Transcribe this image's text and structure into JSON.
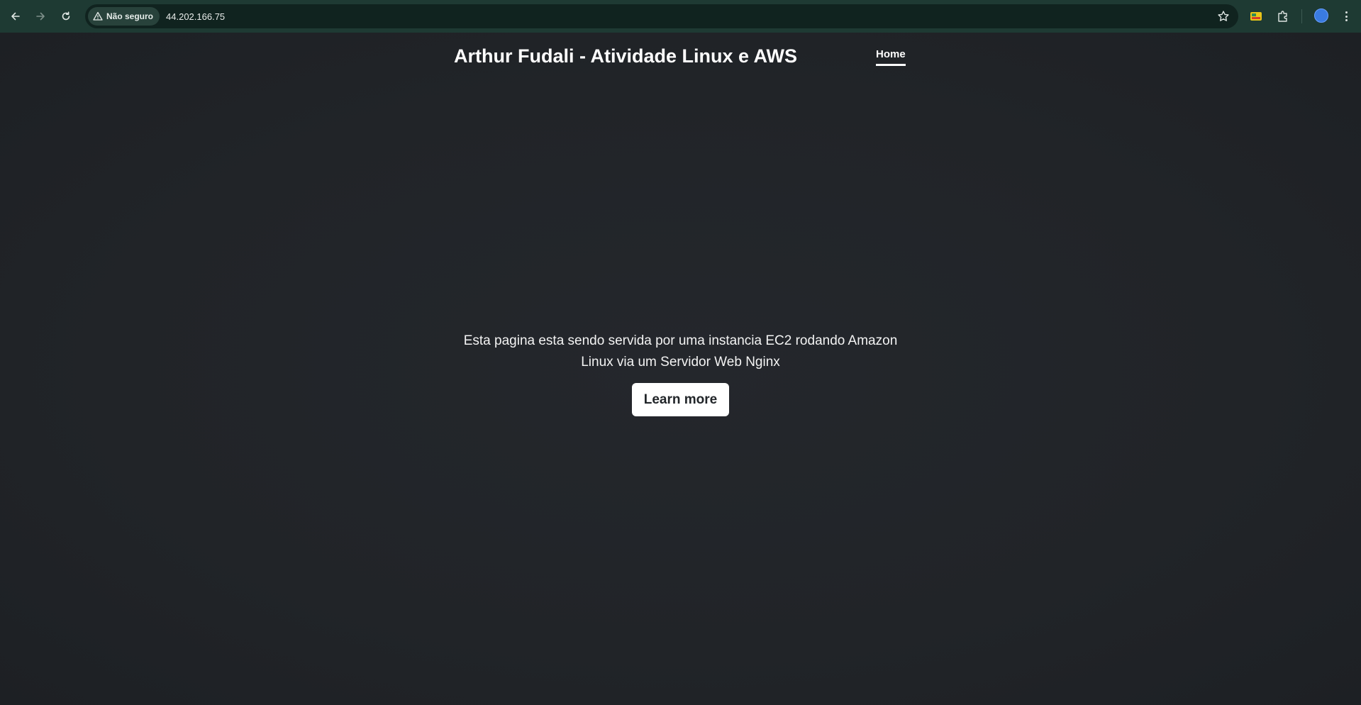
{
  "browser": {
    "security_label": "Não seguro",
    "url": "44.202.166.75"
  },
  "site": {
    "title": "Arthur Fudali - Atividade Linux e AWS",
    "nav": [
      {
        "label": "Home",
        "active": true
      }
    ],
    "hero_text": "Esta pagina esta sendo servida por uma instancia EC2 rodando Amazon Linux via um Servidor Web Nginx",
    "button_label": "Learn more"
  },
  "icons": [
    "back-arrow-icon",
    "forward-arrow-icon",
    "reload-icon",
    "warning-icon",
    "star-icon",
    "extension-icon",
    "puzzle-icon",
    "profile-avatar",
    "menu-dots-icon"
  ],
  "colors": {
    "chrome_bar": "#1e3a33",
    "omnibox": "#10231f",
    "page_background": "#212428",
    "text": "#ffffff",
    "button_bg": "#ffffff",
    "button_text": "#212529"
  }
}
